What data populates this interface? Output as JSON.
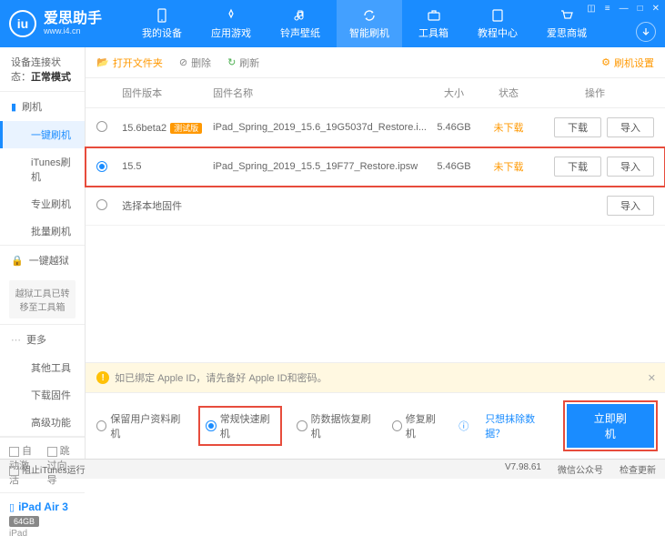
{
  "brand": {
    "name": "爱思助手",
    "url": "www.i4.cn",
    "logo_text": "iu"
  },
  "top_nav": [
    "我的设备",
    "应用游戏",
    "铃声壁纸",
    "智能刷机",
    "工具箱",
    "教程中心",
    "爱思商城"
  ],
  "conn_status": {
    "label": "设备连接状态：",
    "value": "正常模式"
  },
  "sidebar": {
    "sec1": {
      "hdr": "刷机",
      "items": [
        "一键刷机",
        "iTunes刷机",
        "专业刷机",
        "批量刷机"
      ]
    },
    "sec2": {
      "hdr": "一键越狱",
      "note": "越狱工具已转移至工具箱"
    },
    "sec3": {
      "hdr": "更多",
      "items": [
        "其他工具",
        "下载固件",
        "高级功能"
      ]
    },
    "btm_opts": [
      "自动激活",
      "跳过向导"
    ]
  },
  "device": {
    "name": "iPad Air 3",
    "storage": "64GB",
    "type": "iPad"
  },
  "toolbar": {
    "open": "打开文件夹",
    "del": "删除",
    "refresh": "刷新",
    "settings": "刷机设置"
  },
  "table": {
    "headers": {
      "ver": "固件版本",
      "name": "固件名称",
      "size": "大小",
      "stat": "状态",
      "ops": "操作"
    },
    "rows": [
      {
        "ver": "15.6beta2",
        "badge": "测试版",
        "name": "iPad_Spring_2019_15.6_19G5037d_Restore.i...",
        "size": "5.46GB",
        "stat": "未下载",
        "selected": false
      },
      {
        "ver": "15.5",
        "badge": "",
        "name": "iPad_Spring_2019_15.5_19F77_Restore.ipsw",
        "size": "5.46GB",
        "stat": "未下载",
        "selected": true
      }
    ],
    "local_row": "选择本地固件",
    "btn_dl": "下载",
    "btn_imp": "导入"
  },
  "alert": {
    "text": "如已绑定 Apple ID，请先备好 Apple ID和密码。"
  },
  "modes": {
    "opts": [
      "保留用户资料刷机",
      "常规快速刷机",
      "防数据恢复刷机",
      "修复刷机"
    ],
    "link": "只想抹除数据？",
    "flash": "立即刷机"
  },
  "statusbar": {
    "block": "阻止iTunes运行",
    "ver": "V7.98.61",
    "wechat": "微信公众号",
    "update": "检查更新"
  }
}
